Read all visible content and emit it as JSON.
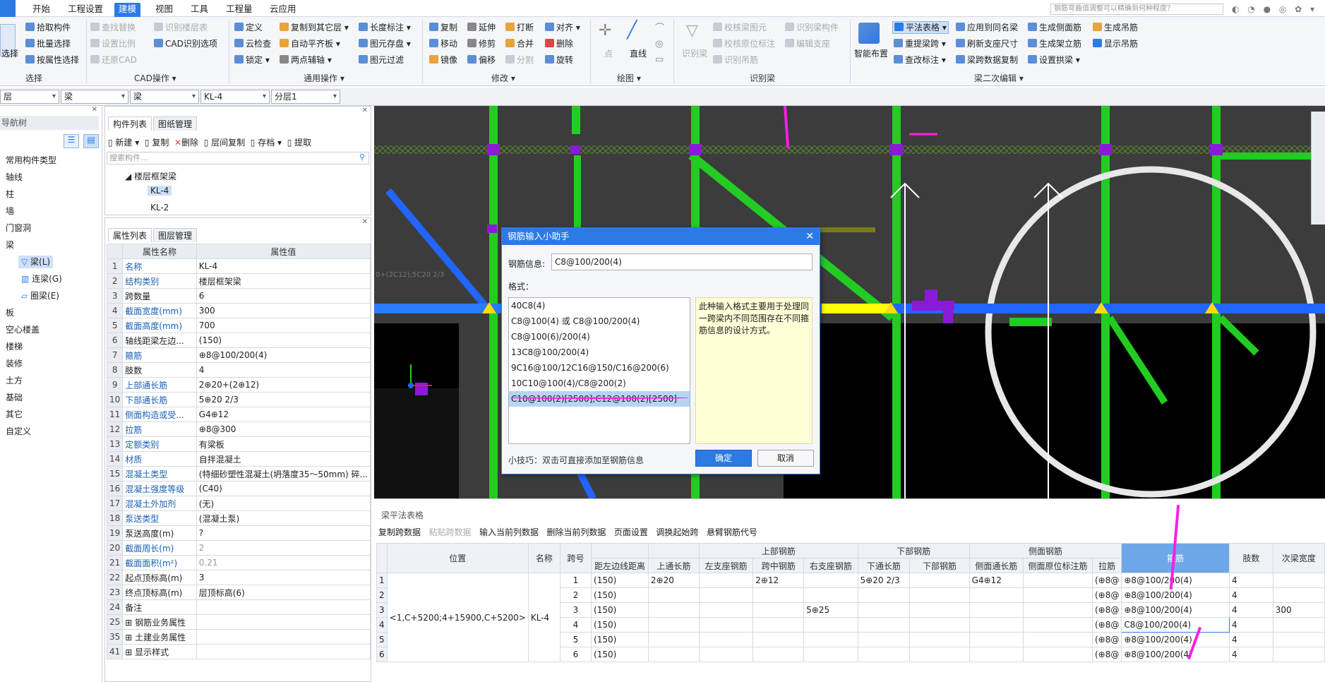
{
  "ribbon": {
    "tabs": [
      "开始",
      "工程设置",
      "建模",
      "视图",
      "工具",
      "工程量",
      "云应用"
    ],
    "active_tab": "建模",
    "search_placeholder": "钢筋弯曲值调整可以精确到何种程度？",
    "groups": {
      "select": {
        "label": "选择",
        "big": "选择",
        "items": [
          "拾取构件",
          "批量选择",
          "按属性选择"
        ]
      },
      "cad": {
        "label": "CAD操作 ▾",
        "items": [
          "查找替换",
          "识别楼层表",
          "设置比例",
          "CAD识别选项",
          "还原CAD"
        ]
      },
      "common": {
        "label": "通用操作 ▾",
        "items": [
          "定义",
          "复制到其它层 ▾",
          "长度标注 ▾",
          "云检查",
          "自动平齐板 ▾",
          "图元存盘 ▾",
          "锁定 ▾",
          "两点辅轴 ▾",
          "图元过滤"
        ]
      },
      "modify": {
        "label": "修改 ▾",
        "items": [
          "复制",
          "延伸",
          "打断",
          "对齐 ▾",
          "移动",
          "修剪",
          "合并",
          "删除",
          "镜像",
          "偏移",
          "分割",
          "旋转"
        ]
      },
      "draw": {
        "label": "绘图 ▾",
        "items": [
          "点",
          "直线"
        ]
      },
      "identify": {
        "label": "识别梁",
        "items": [
          "识别梁",
          "校核梁图元",
          "识别梁构件",
          "校核原位标注",
          "编辑支座",
          "识别吊筋"
        ]
      },
      "beam2": {
        "label": "梁二次编辑 ▾",
        "items": [
          "智能布置",
          "平法表格 ▾",
          "应用到同名梁",
          "生成侧面筋",
          "生成吊筋",
          "重提梁跨 ▾",
          "刷新支座尺寸",
          "生成架立筋",
          "显示吊筋",
          "查改标注 ▾",
          "梁跨数据复制",
          "设置拱梁 ▾"
        ]
      }
    }
  },
  "selectors": [
    "层",
    "梁",
    "梁",
    "KL-4",
    "分层1"
  ],
  "nav": {
    "title": "导航树",
    "items": [
      "常用构件类型",
      "轴线",
      "柱",
      "墙",
      "门窗洞",
      "梁",
      "梁(L)",
      "连梁(G)",
      "圈梁(E)",
      "板",
      "空心楼盖",
      "楼梯",
      "装修",
      "土方",
      "基础",
      "其它",
      "自定义"
    ]
  },
  "components": {
    "tabs": [
      "构件列表",
      "图纸管理"
    ],
    "toolbar": [
      "新建 ▾",
      "复制",
      "删除",
      "层间复制",
      "存档 ▾",
      "提取"
    ],
    "search_placeholder": "搜索构件...",
    "tree_root": "楼层框架梁",
    "items": [
      "KL-4",
      "KL-2"
    ]
  },
  "properties": {
    "tabs": [
      "属性列表",
      "图层管理"
    ],
    "headers": [
      "属性名称",
      "属性值"
    ],
    "rows": [
      {
        "n": "1",
        "k": "名称",
        "v": "KL-4",
        "blue": true
      },
      {
        "n": "2",
        "k": "结构类别",
        "v": "楼层框架梁",
        "blue": true
      },
      {
        "n": "3",
        "k": "跨数量",
        "v": "6",
        "blue": false
      },
      {
        "n": "4",
        "k": "截面宽度(mm)",
        "v": "300",
        "blue": true
      },
      {
        "n": "5",
        "k": "截面高度(mm)",
        "v": "700",
        "blue": true
      },
      {
        "n": "6",
        "k": "轴线距梁左边...",
        "v": "(150)",
        "blue": false
      },
      {
        "n": "7",
        "k": "箍筋",
        "v": "⊕8@100/200(4)",
        "blue": true
      },
      {
        "n": "8",
        "k": "肢数",
        "v": "4",
        "blue": false
      },
      {
        "n": "9",
        "k": "上部通长筋",
        "v": "2⊕20+(2⊕12)",
        "blue": true
      },
      {
        "n": "10",
        "k": "下部通长筋",
        "v": "5⊕20 2/3",
        "blue": true
      },
      {
        "n": "11",
        "k": "侧面构造或受...",
        "v": "G4⊕12",
        "blue": true
      },
      {
        "n": "12",
        "k": "拉筋",
        "v": "⊕8@300",
        "blue": true
      },
      {
        "n": "13",
        "k": "定额类别",
        "v": "有梁板",
        "blue": true
      },
      {
        "n": "14",
        "k": "材质",
        "v": "自拌混凝土",
        "blue": true
      },
      {
        "n": "15",
        "k": "混凝土类型",
        "v": "(特细砂塑性混凝土(坍落度35～50mm) 碎...",
        "blue": true
      },
      {
        "n": "16",
        "k": "混凝土强度等级",
        "v": "(C40)",
        "blue": true
      },
      {
        "n": "17",
        "k": "混凝土外加剂",
        "v": "(无)",
        "blue": true
      },
      {
        "n": "18",
        "k": "泵送类型",
        "v": "(混凝土泵)",
        "blue": true
      },
      {
        "n": "19",
        "k": "泵送高度(m)",
        "v": "?",
        "blue": false
      },
      {
        "n": "20",
        "k": "截面周长(m)",
        "v": "2",
        "blue": true,
        "grey": true
      },
      {
        "n": "21",
        "k": "截面面积(m²)",
        "v": "0.21",
        "blue": true,
        "grey": true
      },
      {
        "n": "22",
        "k": "起点顶标高(m)",
        "v": "3",
        "blue": false
      },
      {
        "n": "23",
        "k": "终点顶标高(m)",
        "v": "层顶标高(6)",
        "blue": false
      },
      {
        "n": "24",
        "k": "备注",
        "v": "",
        "blue": false
      },
      {
        "n": "25",
        "k": "⊞ 钢筋业务属性",
        "v": "",
        "blue": false
      },
      {
        "n": "35",
        "k": "⊞ 土建业务属性",
        "v": "",
        "blue": false
      },
      {
        "n": "41",
        "k": "⊞ 显示样式",
        "v": "",
        "blue": false
      }
    ]
  },
  "canvas": {
    "annotation": "0+(2C12);5C20 2/3"
  },
  "grid": {
    "title": "梁平法表格",
    "toolbar": [
      "复制跨数据",
      "粘贴跨数据",
      "输入当前列数据",
      "删除当前列数据",
      "页面设置",
      "调换起始跨",
      "悬臂钢筋代号"
    ],
    "header_top": [
      "位置",
      "名称",
      "跨号",
      "上部钢筋",
      "下部钢筋",
      "侧面钢筋",
      "箍筋",
      "肢数",
      "次梁宽度"
    ],
    "header_sub": [
      "距左边线距离",
      "上通长筋",
      "左支座钢筋",
      "跨中钢筋",
      "右支座钢筋",
      "下通长筋",
      "下部钢筋",
      "侧面通长筋",
      "侧面原位标注筋",
      "拉筋"
    ],
    "position": "<1,C+5200;4+15900,C+5200>",
    "name": "KL-4",
    "rows": [
      {
        "no": "1",
        "span": "1",
        "dist": "(150)",
        "top": "2⊕20",
        "left": "",
        "mid": "2⊕12",
        "right": "",
        "bot": "5⊕20 2/3",
        "botr": "",
        "side": "G4⊕12",
        "sider": "",
        "tie": "(⊕8@",
        "stir": "⊕8@100/200(4)",
        "legs": "4",
        "sec": ""
      },
      {
        "no": "2",
        "span": "2",
        "dist": "(150)",
        "top": "",
        "left": "",
        "mid": "",
        "right": "",
        "bot": "",
        "botr": "",
        "side": "",
        "sider": "",
        "tie": "(⊕8@",
        "stir": "⊕8@100/200(4)",
        "legs": "4",
        "sec": ""
      },
      {
        "no": "3",
        "span": "3",
        "dist": "(150)",
        "top": "",
        "left": "",
        "mid": "",
        "right": "5⊕25",
        "bot": "",
        "botr": "",
        "side": "",
        "sider": "",
        "tie": "(⊕8@",
        "stir": "⊕8@100/200(4)",
        "legs": "4",
        "sec": "300"
      },
      {
        "no": "4",
        "span": "4",
        "dist": "(150)",
        "top": "",
        "left": "",
        "mid": "",
        "right": "",
        "bot": "",
        "botr": "",
        "side": "",
        "sider": "",
        "tie": "(⊕8@",
        "stir": "C8@100/200(4)",
        "legs": "4",
        "sec": ""
      },
      {
        "no": "5",
        "span": "5",
        "dist": "(150)",
        "top": "",
        "left": "",
        "mid": "",
        "right": "",
        "bot": "",
        "botr": "",
        "side": "",
        "sider": "",
        "tie": "(⊕8@",
        "stir": "⊕8@100/200(4)",
        "legs": "4",
        "sec": ""
      },
      {
        "no": "6",
        "span": "6",
        "dist": "(150)",
        "top": "",
        "left": "",
        "mid": "",
        "right": "",
        "bot": "",
        "botr": "",
        "side": "",
        "sider": "",
        "tie": "(⊕8@",
        "stir": "⊕8@100/200(4)",
        "legs": "4",
        "sec": ""
      }
    ]
  },
  "dialog": {
    "title": "钢筋输入小助手",
    "info_label": "钢筋信息:",
    "info_value": "C8@100/200(4)",
    "format_label": "格式：",
    "formats": [
      "40C8(4)",
      "C8@100(4) 或 C8@100/200(4)",
      "C8@100(6)/200(4)",
      "13C8@100/200(4)",
      "9C16@100/12C16@150/C16@200(6)",
      "10C10@100(4)/C8@200(2)",
      "C10@100(2)[2500];C12@100(2)[2500]"
    ],
    "selected_format": "C10@100(2)[2500];C12@100(2)[2500]",
    "hint": "此种输入格式主要用于处理同一跨梁内不同范围存在不同箍筋信息的设计方式。",
    "tip": "小技巧：双击可直接添加至钢筋信息",
    "ok": "确定",
    "cancel": "取消"
  },
  "colors": {
    "accent": "#2c7be5",
    "column": "#22cc22",
    "beam_blue": "#2266ff",
    "beam_selected": "#ffff00",
    "node": "#8a1ad6",
    "annotation_arrow": "#ff1ee6",
    "canvas_bg": "#3c3c3c"
  }
}
